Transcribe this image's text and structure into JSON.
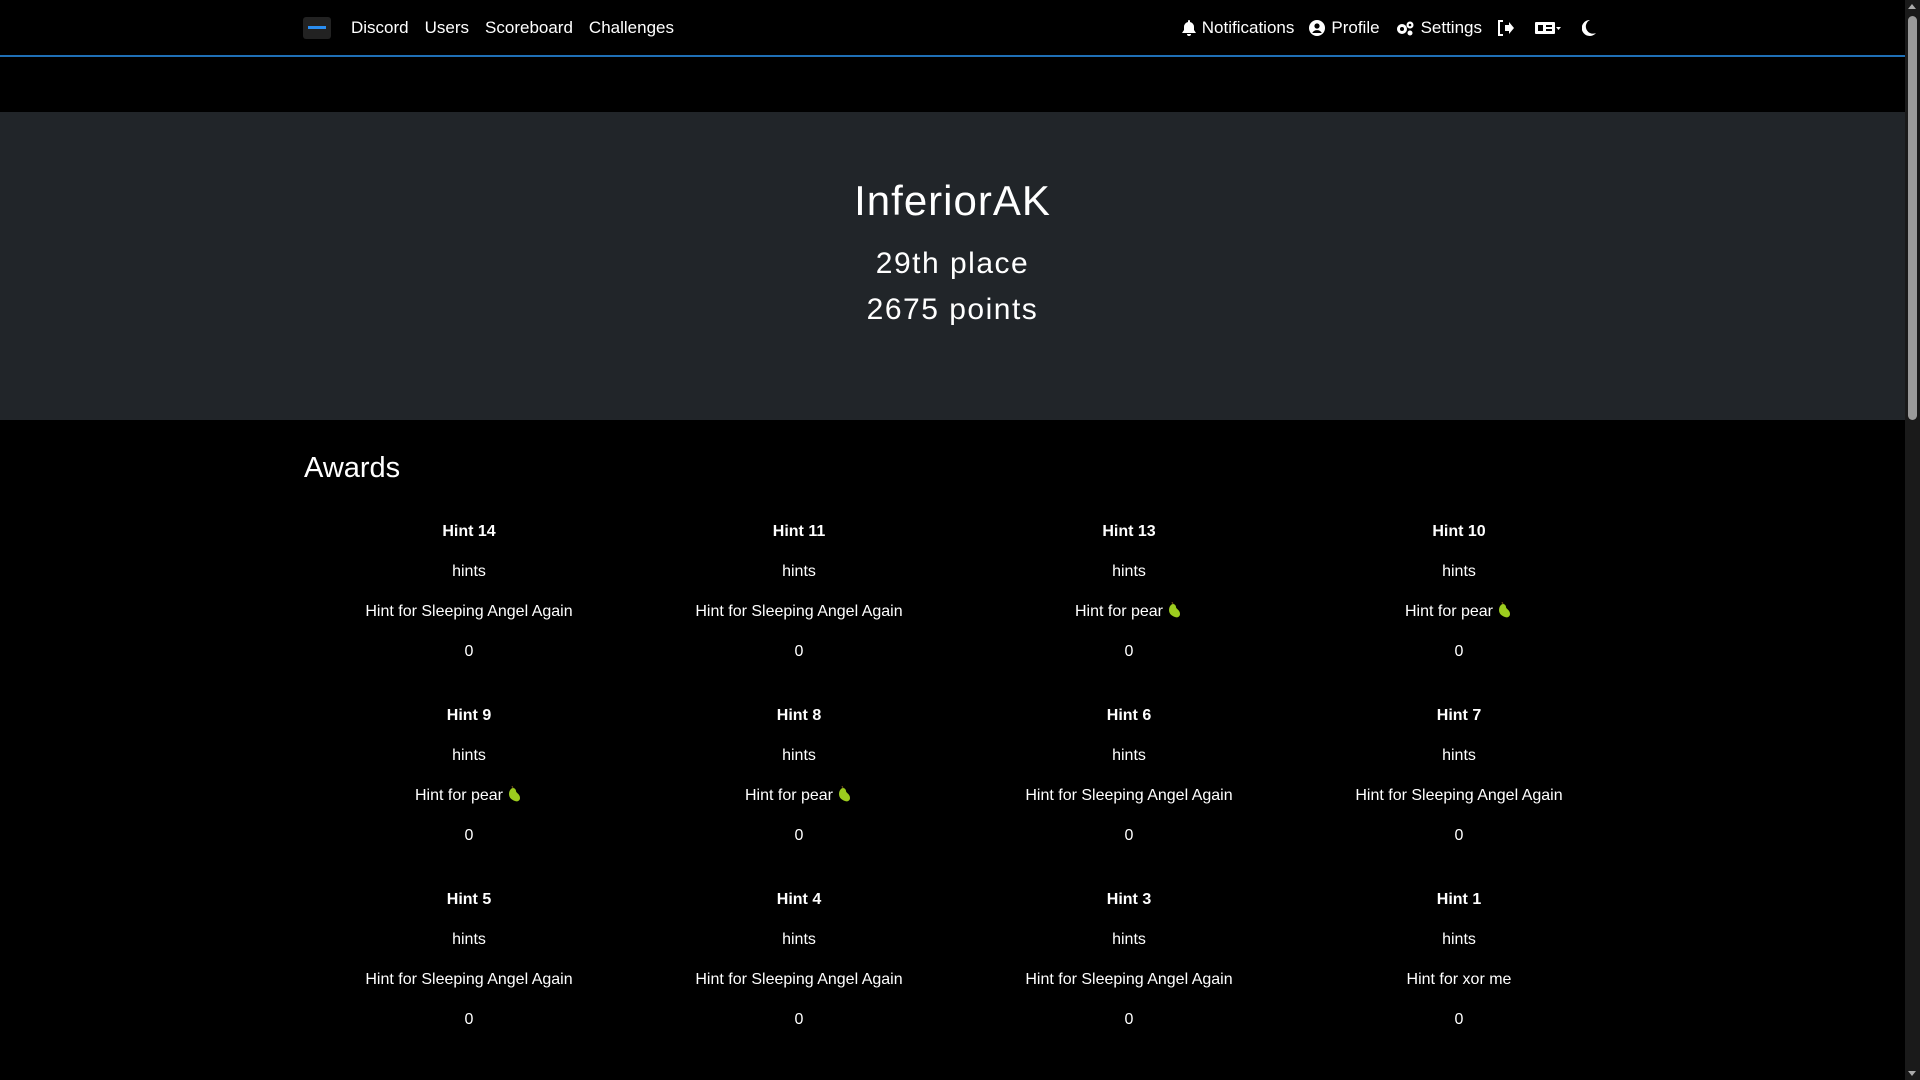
{
  "nav": {
    "left": [
      "Discord",
      "Users",
      "Scoreboard",
      "Challenges"
    ],
    "notifications": "Notifications",
    "profile": "Profile",
    "settings": "Settings"
  },
  "user": {
    "name": "InferiorAK",
    "place": "29th place",
    "points": "2675 points"
  },
  "awards": {
    "title": "Awards",
    "items": [
      {
        "name": "Hint 14",
        "category": "hints",
        "description": "Hint for Sleeping Angel Again",
        "value": "0",
        "pear": false
      },
      {
        "name": "Hint 11",
        "category": "hints",
        "description": "Hint for Sleeping Angel Again",
        "value": "0",
        "pear": false
      },
      {
        "name": "Hint 13",
        "category": "hints",
        "description": "Hint for pear",
        "value": "0",
        "pear": true
      },
      {
        "name": "Hint 10",
        "category": "hints",
        "description": "Hint for pear",
        "value": "0",
        "pear": true
      },
      {
        "name": "Hint 9",
        "category": "hints",
        "description": "Hint for pear",
        "value": "0",
        "pear": true
      },
      {
        "name": "Hint 8",
        "category": "hints",
        "description": "Hint for pear",
        "value": "0",
        "pear": true
      },
      {
        "name": "Hint 6",
        "category": "hints",
        "description": "Hint for Sleeping Angel Again",
        "value": "0",
        "pear": false
      },
      {
        "name": "Hint 7",
        "category": "hints",
        "description": "Hint for Sleeping Angel Again",
        "value": "0",
        "pear": false
      },
      {
        "name": "Hint 5",
        "category": "hints",
        "description": "Hint for Sleeping Angel Again",
        "value": "0",
        "pear": false
      },
      {
        "name": "Hint 4",
        "category": "hints",
        "description": "Hint for Sleeping Angel Again",
        "value": "0",
        "pear": false
      },
      {
        "name": "Hint 3",
        "category": "hints",
        "description": "Hint for Sleeping Angel Again",
        "value": "0",
        "pear": false
      },
      {
        "name": "Hint 1",
        "category": "hints",
        "description": "Hint for xor me",
        "value": "0",
        "pear": false
      }
    ]
  },
  "colors": {
    "accent": "#1f6fb5",
    "jumbotron": "#212529",
    "pear": "#9ccc1e"
  },
  "icons": {
    "pear": "pear-icon"
  }
}
